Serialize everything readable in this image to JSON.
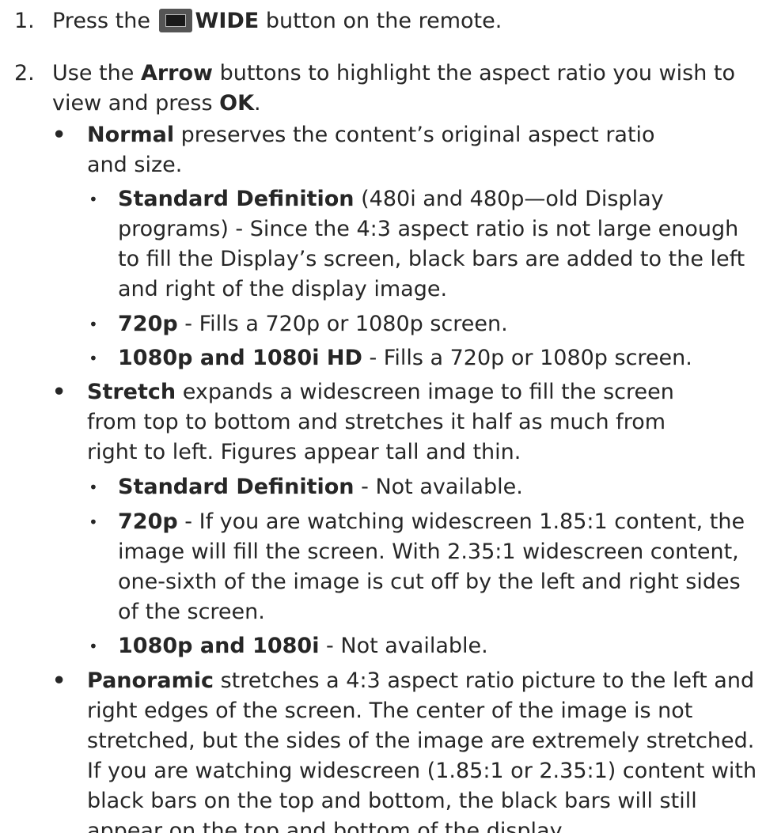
{
  "steps": [
    {
      "number": "1.",
      "pre": "Press the",
      "icon": "wide-button-icon",
      "bold": "WIDE",
      "post": "button on the remote."
    },
    {
      "number": "2.",
      "pre": "Use the",
      "bold1": "Arrow",
      "mid": "buttons to highlight the aspect ratio you wish to view and press",
      "bold2": "OK",
      "end": "."
    }
  ],
  "modes": [
    {
      "name": "Normal",
      "description": "preserves the content’s original aspect ratio and size.",
      "items": [
        {
          "label": "Standard Definition",
          "text": "(480i and 480p—old Display programs) - Since the 4:3 aspect ratio is not large enough to fill the Display’s screen, black bars are added to the left and right of the display image."
        },
        {
          "label": "720p",
          "text": "- Fills a 720p or 1080p screen."
        },
        {
          "label": "1080p and 1080i HD",
          "text": "- Fills a 720p or 1080p screen."
        }
      ]
    },
    {
      "name": "Stretch",
      "description": "expands a widescreen image to fill the screen from top to bottom and stretches it half as much from right to left. Figures appear tall and thin.",
      "items": [
        {
          "label": "Standard Definition",
          "text": "- Not available."
        },
        {
          "label": "720p",
          "text": "- If you are watching widescreen 1.85:1 content, the image will fill the screen. With 2.35:1 widescreen content, one-sixth of the image is cut off by the left and right sides of the screen."
        },
        {
          "label": "1080p and 1080i",
          "text": "- Not available."
        }
      ]
    },
    {
      "name": "Panoramic",
      "description": "stretches a 4:3 aspect ratio picture to the left and right edges of the screen. The center of the image is not stretched, but the sides of the image are extremely stretched. If you are watching widescreen (1.85:1 or 2.35:1) content with black bars on the top and bottom, the black bars will still appear on the top and bottom of the display"
    }
  ]
}
